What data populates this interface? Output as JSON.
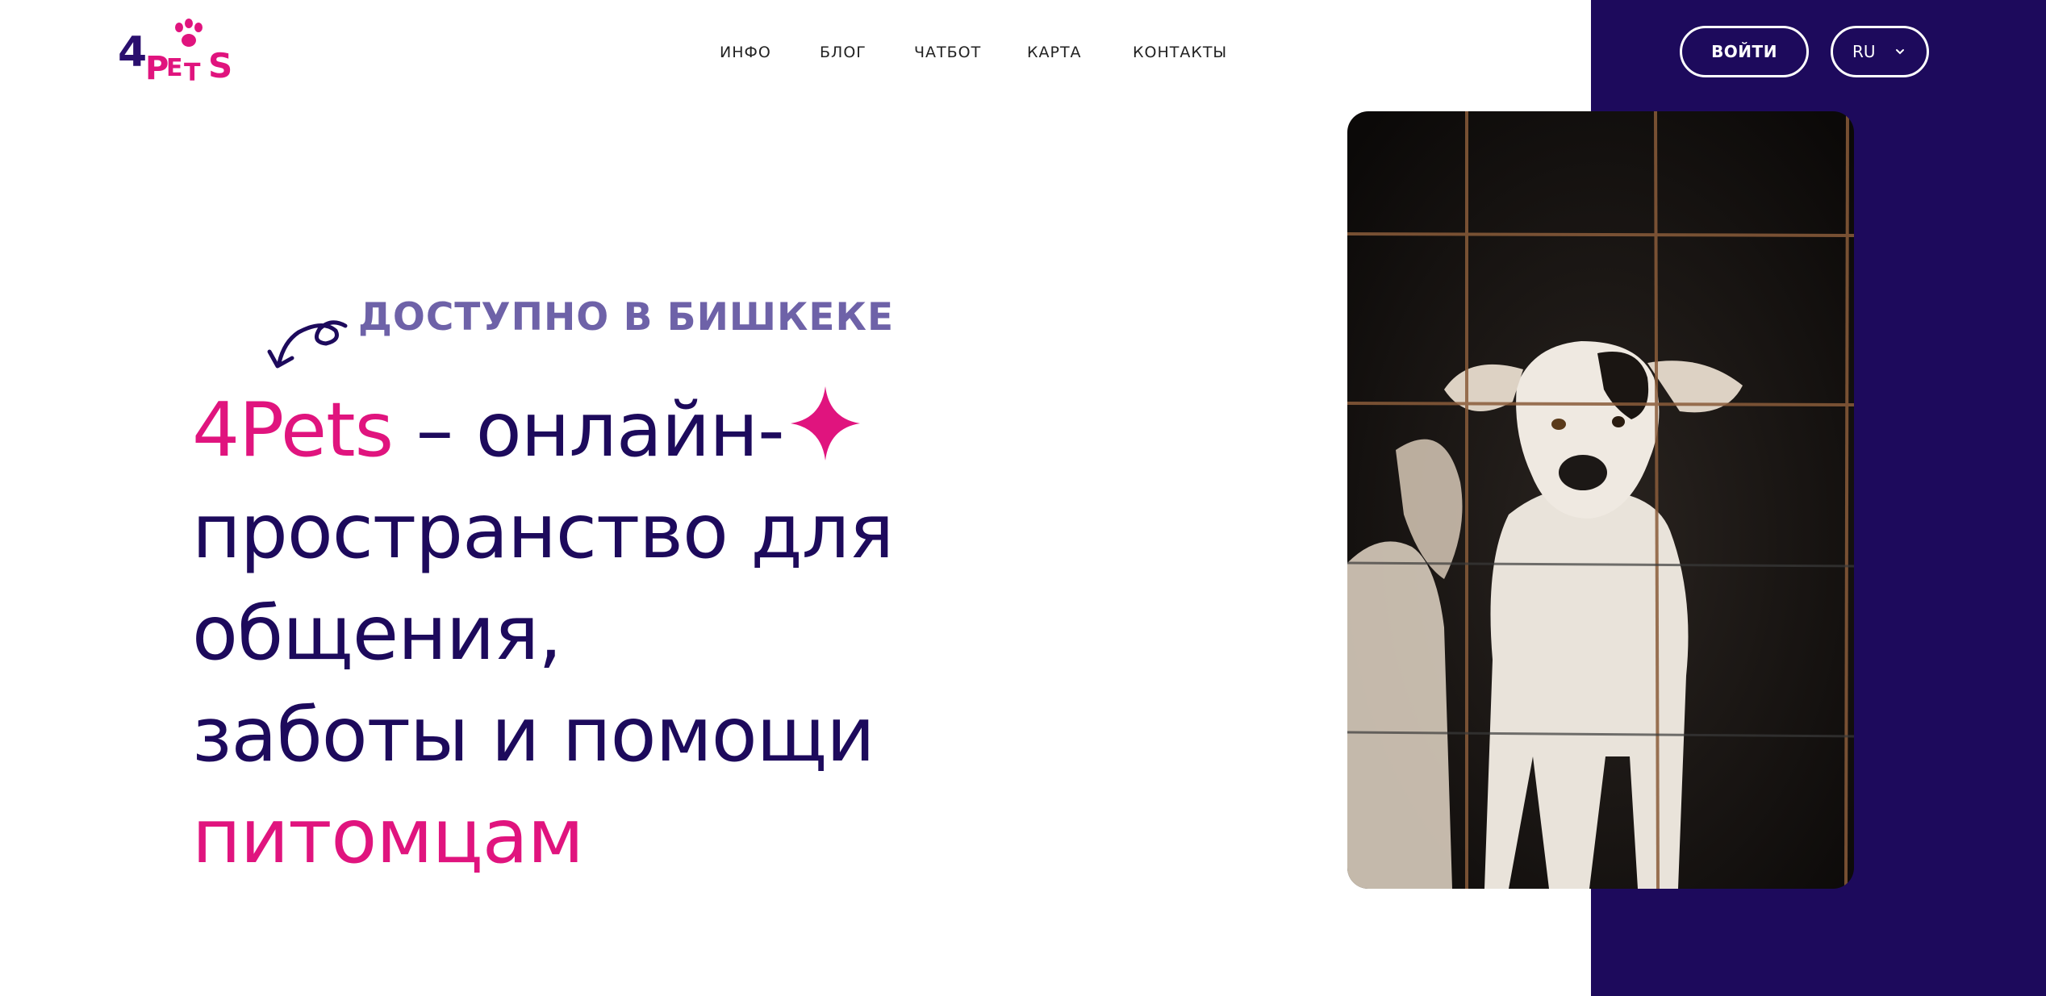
{
  "brand": {
    "logo_text": "4PETS"
  },
  "nav": {
    "items": [
      {
        "label": "ИНФО"
      },
      {
        "label": "БЛОГ"
      },
      {
        "label": "ЧАТБОТ"
      },
      {
        "label": "КАРТА"
      },
      {
        "label": "КОНТАКТЫ"
      }
    ]
  },
  "header": {
    "login_label": "ВОЙТИ",
    "language": "RU"
  },
  "hero": {
    "tagline": "ДОСТУПНО В БИШКЕКЕ",
    "brand_word": "4Pets",
    "line1_rest": " – онлайн-",
    "line2": "пространство для общения,",
    "line3_start": "заботы и помощи ",
    "line3_accent": "питомцам"
  },
  "colors": {
    "primary": "#1d0a5c",
    "accent": "#e0147e",
    "tagline": "#6e62a8",
    "background": "#ffffff"
  },
  "icons": [
    "paw-icon",
    "curved-arrow-icon",
    "sparkle-star-icon",
    "chevron-down-icon"
  ]
}
